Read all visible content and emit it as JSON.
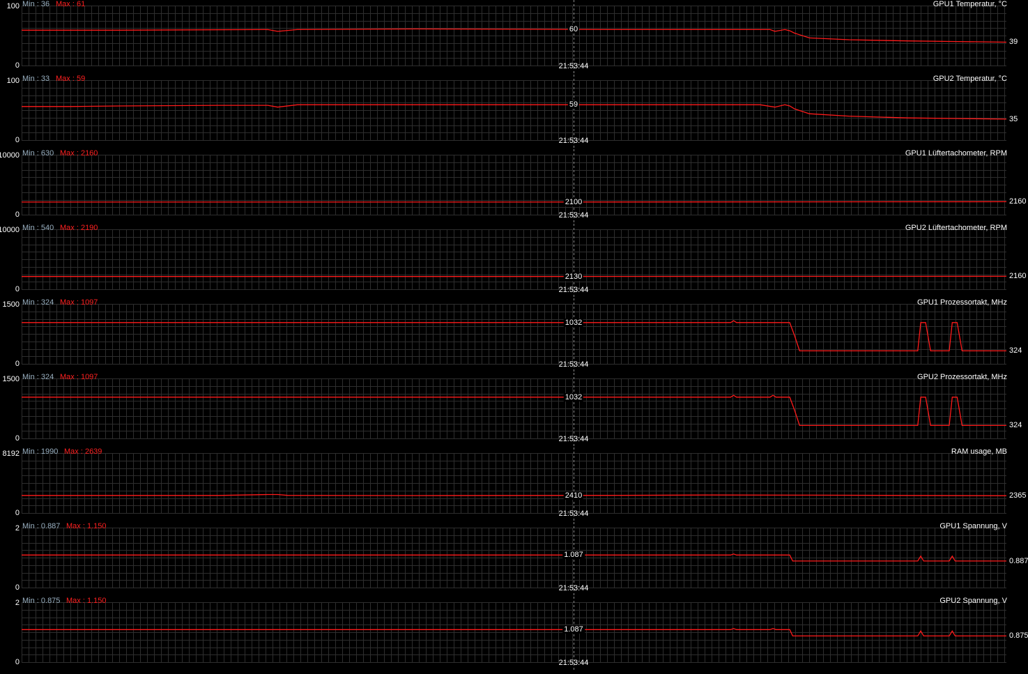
{
  "colors": {
    "background": "#000000",
    "grid": "#2e2e2e",
    "trace": "#ff1a1a",
    "min_label": "#9ab1c2",
    "max_label": "#ff2020",
    "cursor": "#8c8c8c"
  },
  "chart_data": [
    {
      "type": "line",
      "title": "GPU1 Temperatur, °C",
      "min_label": "Min : 36",
      "max_label": "Max : 61",
      "ylim": [
        0,
        100
      ],
      "ytick_top": "100",
      "ytick_bottom": "0",
      "current_value": "39",
      "cursor_value": "60",
      "cursor_time": "21:53:44",
      "x": [
        0,
        10,
        25,
        26,
        28,
        40,
        60,
        70,
        76,
        76.5,
        77.5,
        78,
        78.5,
        80,
        84,
        90,
        95,
        100
      ],
      "y": [
        59,
        59,
        60,
        57,
        60,
        61,
        60,
        60,
        60,
        57,
        60,
        58,
        54,
        46,
        43,
        41,
        40,
        39
      ]
    },
    {
      "type": "line",
      "title": "GPU2 Temperatur, °C",
      "min_label": "Min : 33",
      "max_label": "Max : 59",
      "ylim": [
        0,
        100
      ],
      "ytick_top": "100",
      "ytick_bottom": "0",
      "current_value": "35",
      "cursor_value": "59",
      "cursor_time": "21:53:44",
      "x": [
        0,
        5,
        10,
        20,
        25,
        26,
        28,
        40,
        60,
        70,
        75,
        76.5,
        77.5,
        78,
        78.5,
        80,
        84,
        90,
        95,
        100
      ],
      "y": [
        56,
        56,
        57,
        58,
        58,
        55,
        59,
        59,
        59,
        59,
        59,
        55,
        59,
        57,
        52,
        44,
        40,
        37,
        36,
        35
      ]
    },
    {
      "type": "line",
      "title": "GPU1 Lüftertachometer, RPM",
      "min_label": "Min : 630",
      "max_label": "Max : 2160",
      "ylim": [
        0,
        10000
      ],
      "ytick_top": "10000",
      "ytick_bottom": "0",
      "current_value": "2160",
      "cursor_value": "2100",
      "cursor_time": "21:53:44",
      "x": [
        0,
        50,
        100
      ],
      "y": [
        2100,
        2100,
        2160
      ]
    },
    {
      "type": "line",
      "title": "GPU2 Lüftertachometer, RPM",
      "min_label": "Min : 540",
      "max_label": "Max : 2190",
      "ylim": [
        0,
        10000
      ],
      "ytick_top": "10000",
      "ytick_bottom": "0",
      "current_value": "2160",
      "cursor_value": "2130",
      "cursor_time": "21:53:44",
      "x": [
        0,
        50,
        100
      ],
      "y": [
        2130,
        2130,
        2160
      ]
    },
    {
      "type": "line",
      "title": "GPU1 Prozessortakt, MHz",
      "min_label": "Min : 324",
      "max_label": "Max : 1097",
      "ylim": [
        0,
        1500
      ],
      "ytick_top": "1500",
      "ytick_bottom": "0",
      "current_value": "324",
      "cursor_value": "1032",
      "cursor_time": "21:53:44",
      "x": [
        0,
        72,
        72.3,
        72.6,
        78,
        78.5,
        79,
        91,
        91.3,
        91.8,
        92.3,
        94.2,
        94.5,
        95,
        95.5,
        100
      ],
      "y": [
        1032,
        1032,
        1080,
        1032,
        1032,
        700,
        324,
        324,
        1032,
        1032,
        324,
        324,
        1032,
        1032,
        324,
        324
      ]
    },
    {
      "type": "line",
      "title": "GPU2 Prozessortakt, MHz",
      "min_label": "Min : 324",
      "max_label": "Max : 1097",
      "ylim": [
        0,
        1500
      ],
      "ytick_top": "1500",
      "ytick_bottom": "0",
      "current_value": "324",
      "cursor_value": "1032",
      "cursor_time": "21:53:44",
      "x": [
        0,
        72,
        72.3,
        72.6,
        76,
        76.3,
        76.6,
        78,
        78.5,
        79,
        91,
        91.3,
        91.8,
        92.3,
        94.2,
        94.5,
        95,
        95.5,
        100
      ],
      "y": [
        1032,
        1032,
        1080,
        1032,
        1032,
        1080,
        1032,
        1032,
        700,
        324,
        324,
        1032,
        1032,
        324,
        324,
        1032,
        1032,
        324,
        324
      ]
    },
    {
      "type": "line",
      "title": "RAM usage, MB",
      "min_label": "Min : 1990",
      "max_label": "Max : 2639",
      "ylim": [
        0,
        8192
      ],
      "ytick_top": "8192",
      "ytick_bottom": "0",
      "current_value": "2365",
      "cursor_value": "2410",
      "cursor_time": "21:53:44",
      "x": [
        0,
        20,
        25,
        26,
        27,
        40,
        60,
        70,
        80,
        90,
        100
      ],
      "y": [
        2400,
        2400,
        2520,
        2520,
        2410,
        2380,
        2410,
        2460,
        2440,
        2400,
        2365
      ]
    },
    {
      "type": "line",
      "title": "GPU1 Spannung, V",
      "min_label": "Min : 0.887",
      "max_label": "Max : 1.150",
      "ylim": [
        0,
        2
      ],
      "ytick_top": "2",
      "ytick_bottom": "0",
      "current_value": "0.887",
      "cursor_value": "1.087",
      "cursor_time": "21:53:44",
      "x": [
        0,
        72,
        72.3,
        72.6,
        78,
        78.3,
        78.6,
        91,
        91.3,
        91.6,
        94.2,
        94.5,
        94.8,
        100
      ],
      "y": [
        1.087,
        1.087,
        1.12,
        1.087,
        1.087,
        0.887,
        0.887,
        0.887,
        1.05,
        0.887,
        0.887,
        1.05,
        0.887,
        0.887
      ]
    },
    {
      "type": "line",
      "title": "GPU2 Spannung, V",
      "min_label": "Min : 0.875",
      "max_label": "Max : 1.150",
      "ylim": [
        0,
        2
      ],
      "ytick_top": "2",
      "ytick_bottom": "0",
      "current_value": "0.875",
      "cursor_value": "1.087",
      "cursor_time": "21:53:44",
      "x": [
        0,
        72,
        72.3,
        72.6,
        76,
        76.3,
        76.6,
        78,
        78.3,
        78.6,
        91,
        91.3,
        91.6,
        94.2,
        94.5,
        94.8,
        100
      ],
      "y": [
        1.087,
        1.087,
        1.12,
        1.087,
        1.087,
        1.12,
        1.087,
        1.087,
        0.875,
        0.875,
        0.875,
        1.04,
        0.875,
        0.875,
        1.04,
        0.875,
        0.875
      ]
    }
  ]
}
